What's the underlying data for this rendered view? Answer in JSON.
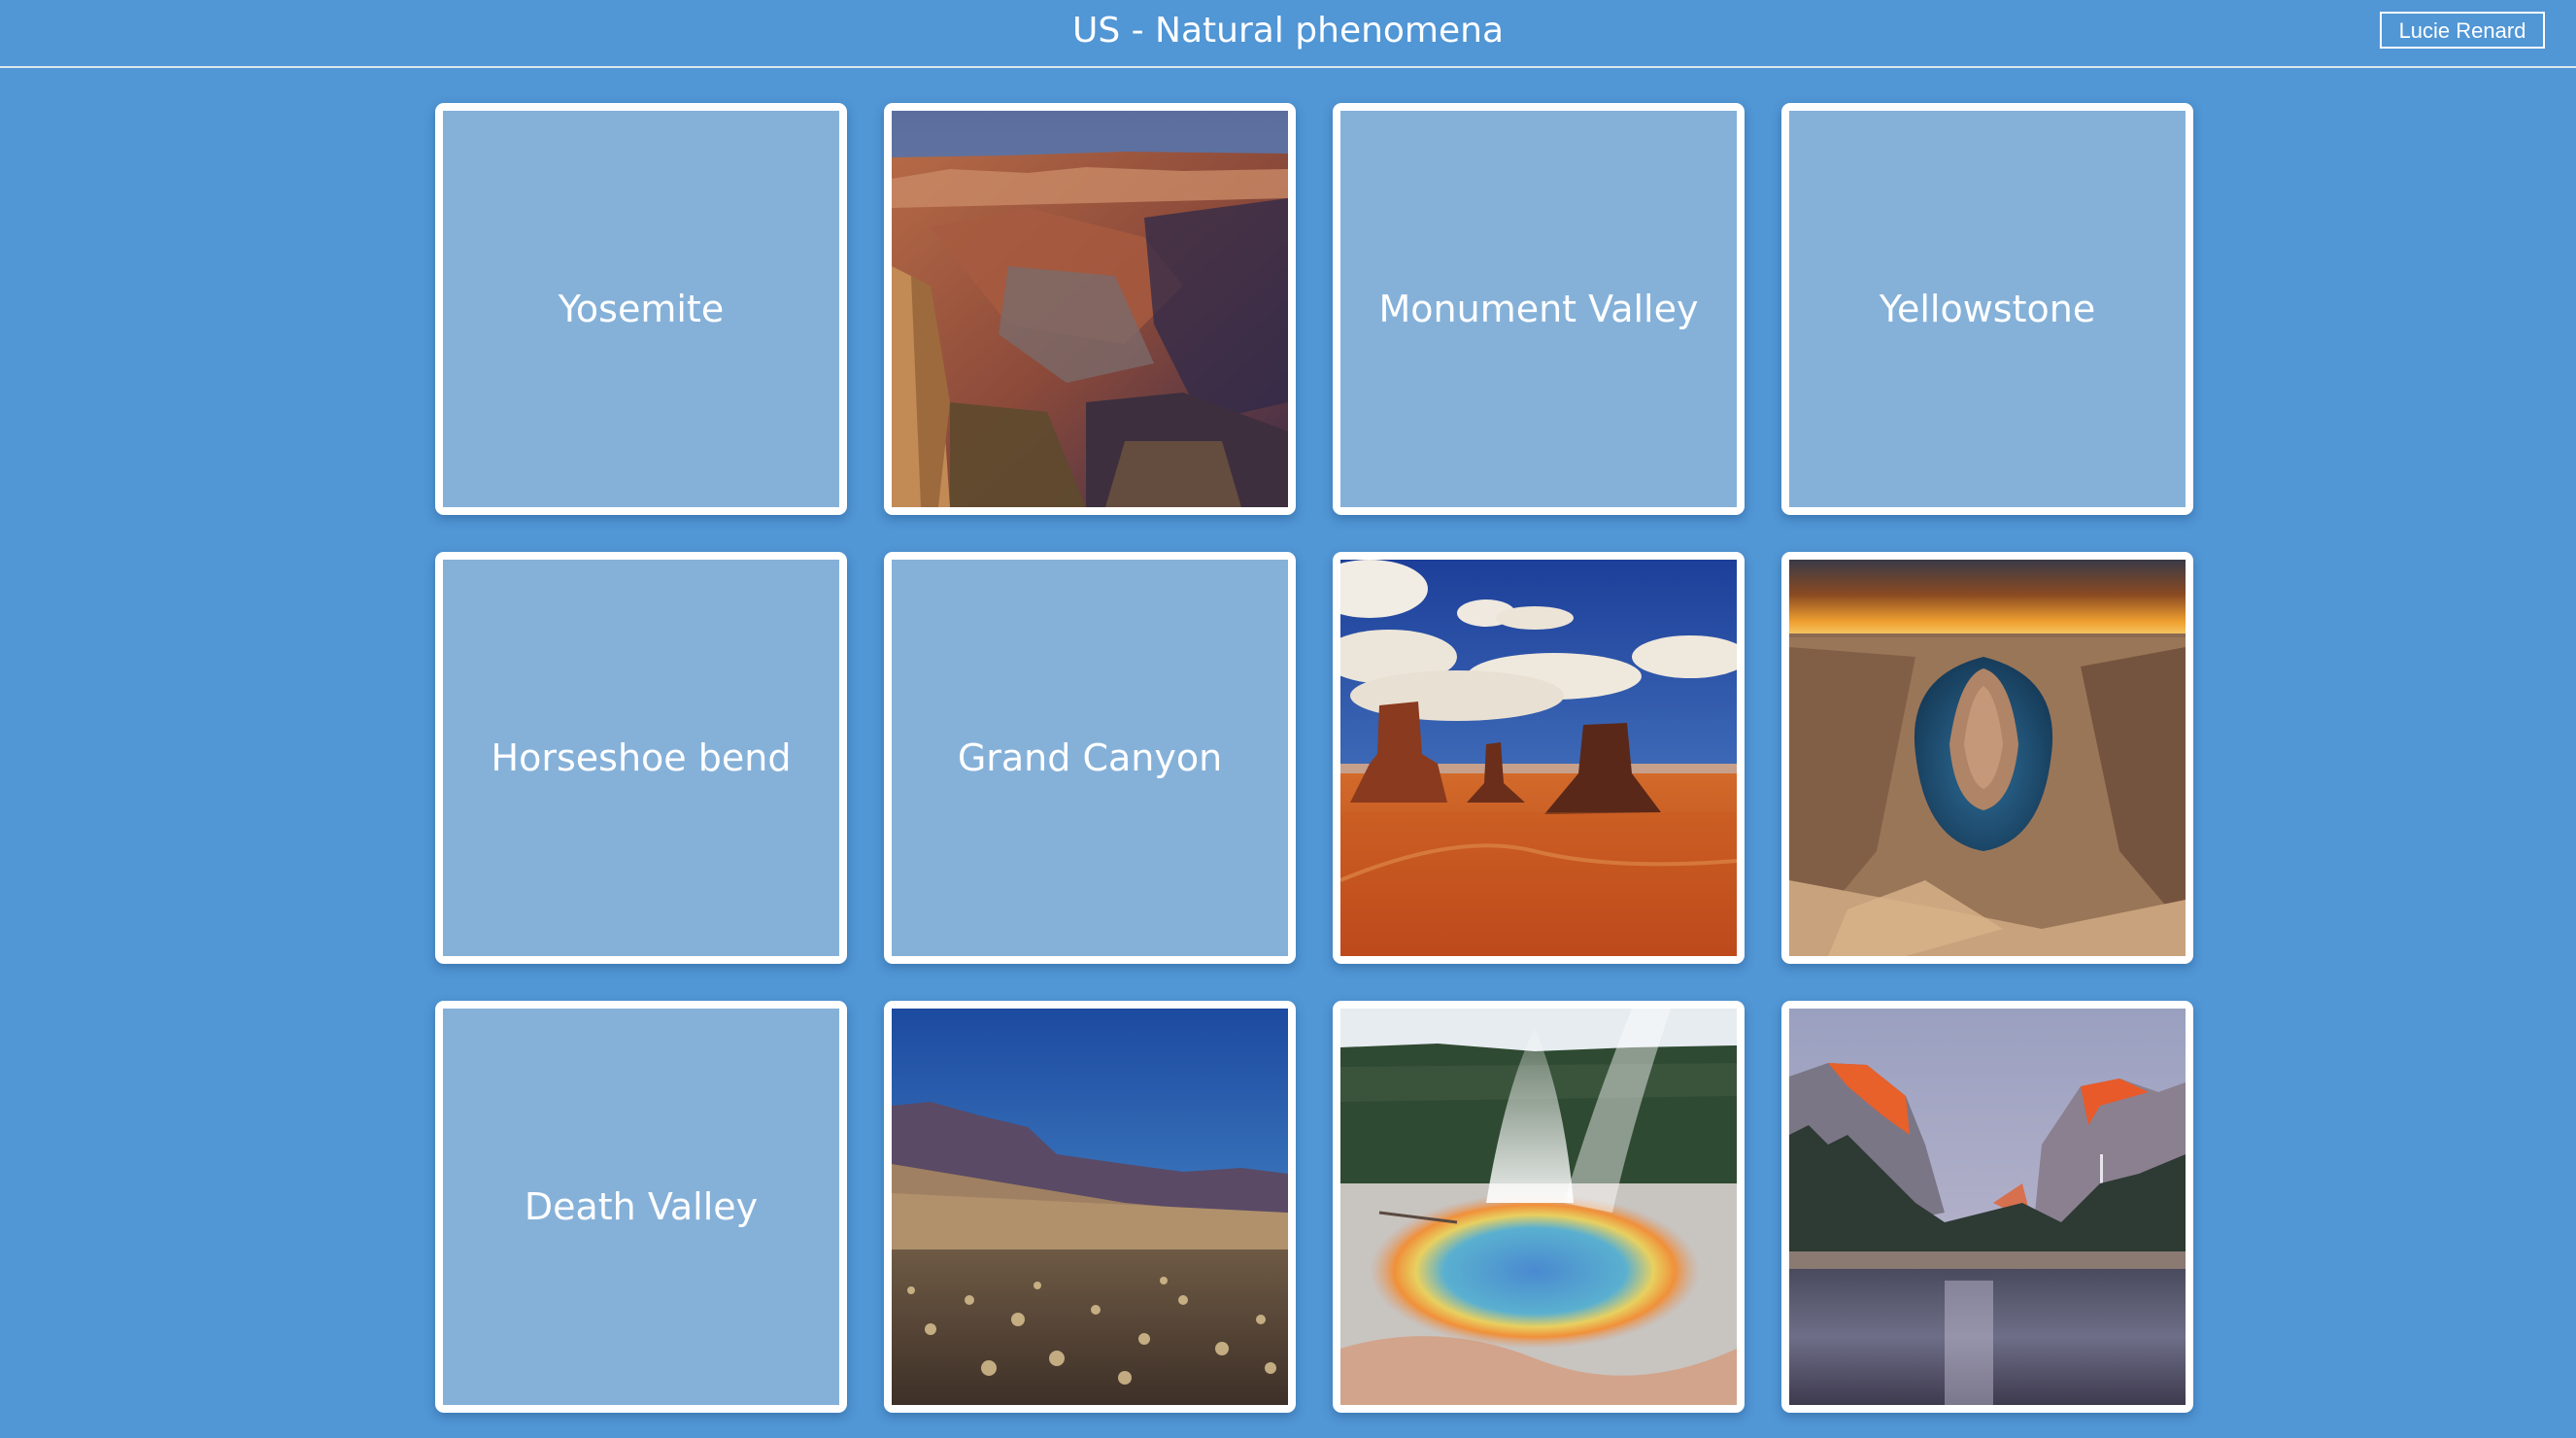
{
  "header": {
    "title": "US - Natural phenomena",
    "user_name": "Lucie Renard"
  },
  "colors": {
    "background": "#5196d5",
    "card_label_fill": "#85b1d9",
    "card_border": "#ffffff",
    "text": "#ffffff"
  },
  "cards": [
    {
      "type": "label",
      "label": "Yosemite"
    },
    {
      "type": "photo",
      "subject": "Grand Canyon",
      "icon": "grand-canyon-photo"
    },
    {
      "type": "label",
      "label": "Monument Valley"
    },
    {
      "type": "label",
      "label": "Yellowstone"
    },
    {
      "type": "label",
      "label": "Horseshoe bend"
    },
    {
      "type": "label",
      "label": "Grand Canyon"
    },
    {
      "type": "photo",
      "subject": "Monument Valley",
      "icon": "monument-valley-photo"
    },
    {
      "type": "photo",
      "subject": "Horseshoe bend",
      "icon": "horseshoe-bend-photo"
    },
    {
      "type": "label",
      "label": "Death Valley"
    },
    {
      "type": "photo",
      "subject": "Death Valley",
      "icon": "death-valley-photo"
    },
    {
      "type": "photo",
      "subject": "Yellowstone",
      "icon": "yellowstone-photo"
    },
    {
      "type": "photo",
      "subject": "Yosemite",
      "icon": "yosemite-photo"
    }
  ]
}
